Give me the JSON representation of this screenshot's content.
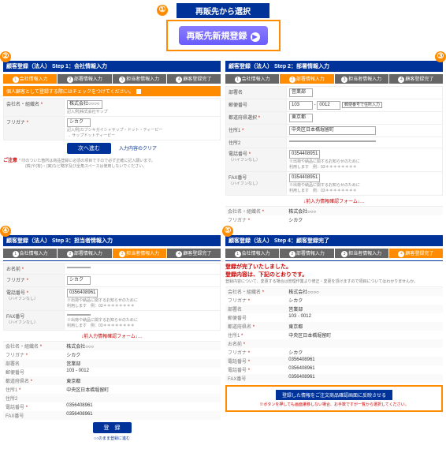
{
  "section1": {
    "title": "再販先から選択",
    "register_btn": "再販先新規登録"
  },
  "panels": {
    "step1": {
      "title": "顧客登録（法人） Step 1：会社情報入力",
      "note": "個人顧客として登録する際にはチェックをつけてください。",
      "fields": {
        "company_label": "会社名・組織名",
        "company_value": "株式会社○○○○",
        "company_ex": "記入例)株式会社サップ",
        "furi_label": "フリガナ",
        "furi_value": "シカク",
        "furi_ex1": "記入例)カブシキガイシャサップ・ドット・ティーピー",
        "furi_ex2": "→ サップドットティーピー"
      },
      "next_btn": "次へ進む",
      "clear": "入力内容のクリア",
      "caution_label": "ご注意",
      "caution_text1": "* 印のついた箇所は商品登録に必須の項目ですので必ず正確に記入願います。",
      "caution_text2": "(株)や(有)・(実)など略字及び全角スペースは使用しないでください。"
    },
    "step2": {
      "title": "顧客登録（法人） Step 2：部署情報入力",
      "fields": {
        "busho_label": "部署名",
        "busho_value": "営業部",
        "zip_label": "郵便番号",
        "zip1": "103",
        "zip2": "0012",
        "zip_btn": "郵便番号で住所入力",
        "pref_label": "都道府県選択",
        "pref_value": "東京都",
        "addr1_label": "住所1",
        "addr1_value": "中央区日本橋堀留町",
        "addr2_label": "住所2",
        "tel_label": "電話番号",
        "tel_sub": "（ハイフンなし）",
        "tel_value": "0354408951",
        "tel_ex": "※出荷や納品に関するお知らせのために",
        "tel_ex2": "利用します　例：03＊＊＊＊＊＊＊＊",
        "fax_label": "FAX番号",
        "fax_sub": "（ハイフンなし）",
        "fax_value": "0354408951",
        "fax_ex": "※出荷や納品に関するお知らせのために",
        "fax_ex2": "利用します　例：03＊＊＊＊＊＊＊＊"
      },
      "confirm": "↓前入力情報確認フォーム↓…",
      "prev_company_label": "会社名・組織名",
      "prev_company_value": "株式会社○○○",
      "prev_furi_label": "フリガナ",
      "prev_furi_value": "シカク"
    },
    "step3": {
      "title": "顧客登録（法人） Step 3：担当者情報入力",
      "fields": {
        "name_label": "お名前",
        "furi_label": "フリガナ",
        "furi_value": "シカク",
        "tel_label": "電話番号",
        "tel_sub": "（ハイフンなし）",
        "tel_value": "0356408961",
        "tel_ex": "※出荷や納品に関するお知らせのために",
        "tel_ex2": "利用します　例：03＊＊＊＊＊＊＊＊",
        "fax_label": "FAX番号",
        "fax_sub": "（ハイフンなし）",
        "fax_ex": "※出荷や納品に関するお知らせのために",
        "fax_ex2": "利用します　例：03＊＊＊＊＊＊＊＊"
      },
      "confirm": "↓前入力情報確認フォーム↓…",
      "summary": {
        "company_label": "会社名・組織名",
        "company": "株式会社○○○",
        "furi_label": "フリガナ",
        "furi": "シカク",
        "busho_label": "部署名",
        "busho": "営業部",
        "zip_label": "郵便番号",
        "zip": "103 - 0012",
        "pref_label": "都道府県名",
        "pref": "東京都",
        "addr1_label": "住所1",
        "addr1": "中央区日本橋堀留町",
        "addr2_label": "住所2",
        "addr2": "",
        "tel_label": "電話番号",
        "tel": "0356408961",
        "fax_label": "FAX番号",
        "fax": "0356408961"
      },
      "submit": "登　録",
      "sub_link": "○○のまま登録に進む"
    },
    "step4": {
      "title": "顧客登録（法人） Step 4：顧客登録完了",
      "done1": "登録が完了いたしました。",
      "done2": "登録内容は、下記のとおりです。",
      "done_note": "登録内容について、変更する場合は管理作業より修正・変更を頂けますので項目についてはわかりませんか。",
      "summary": {
        "company_label": "会社名・組織名",
        "company": "株式会社○○○○",
        "furi_label": "フリガナ",
        "furi": "シカク",
        "busho_label": "部署名",
        "busho": "営業部",
        "zip_label": "郵便番号",
        "zip": "103 - 0012",
        "pref_label": "都道府県名",
        "pref": "東京都",
        "addr1_label": "住所1",
        "addr1": "中央区日本橋堀留町",
        "name_label": "お名前",
        "name": "",
        "pfuri_label": "フリガナ",
        "pfuri": "シカク",
        "tel_label": "電話番号",
        "tel": "0356408961",
        "ptel_label": "電話番号",
        "ptel": "0356408961",
        "fax_label": "FAX番号",
        "fax": "0356408961"
      },
      "reflect_btn": "登録した情報をご注文商品確認画面に反映させる",
      "reflect_note": "※ボタンを押しても画面遷移しない場合、お手数ですが一覧から選択してください。"
    }
  },
  "steps": {
    "s1": "会社情報入力",
    "s2": "部署情報入力",
    "s3": "担当者情報入力",
    "s4": "顧客登録完了"
  }
}
